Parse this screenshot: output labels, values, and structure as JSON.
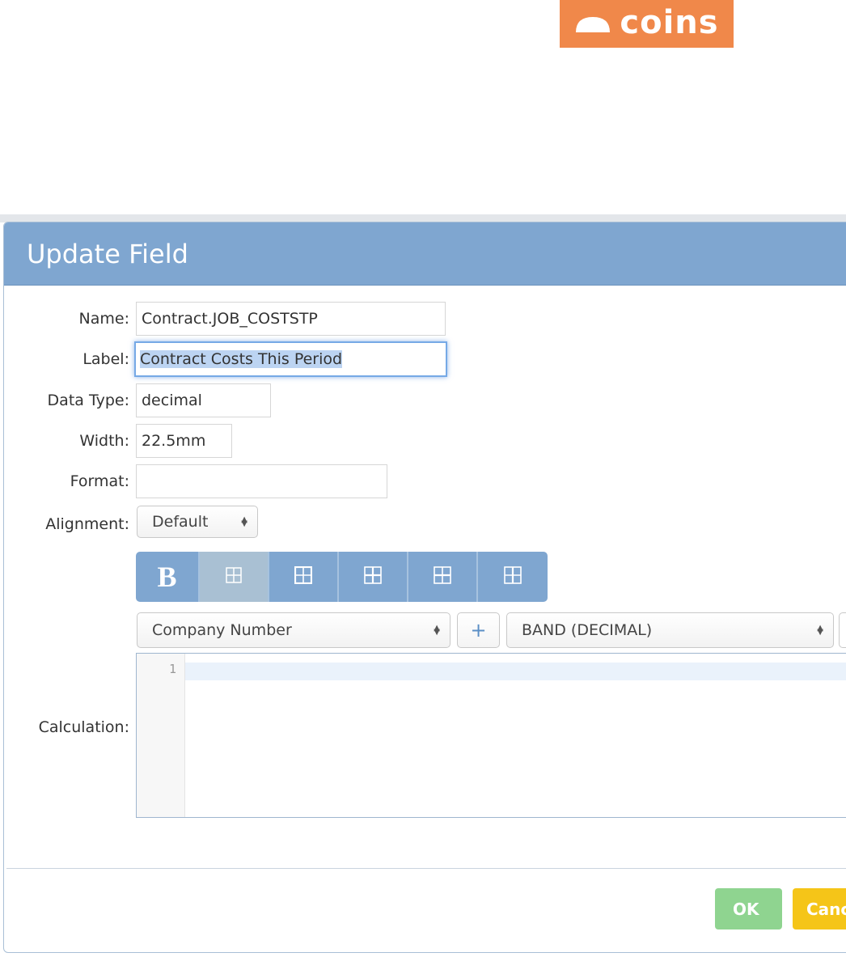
{
  "brand": {
    "logo_text": "coins",
    "color": "#f0884a",
    "icon": "hard-hat-icon"
  },
  "dialog": {
    "title": "Update Field",
    "header_color": "#7fa6d0"
  },
  "form": {
    "name": {
      "label": "Name:",
      "value": "Contract.JOB_COSTSTP"
    },
    "field_label": {
      "label": "Label:",
      "value": "Contract Costs This Period"
    },
    "data_type": {
      "label": "Data Type:",
      "value": "decimal"
    },
    "width": {
      "label": "Width:",
      "value": "22.5mm"
    },
    "format": {
      "label": "Format:",
      "value": ""
    },
    "alignment": {
      "label": "Alignment:",
      "selected": "Default"
    },
    "calculation": {
      "label": "Calculation:",
      "line_number": "1",
      "code": ""
    }
  },
  "toolbar": {
    "bold_label": "B",
    "buttons": [
      {
        "name": "bold",
        "icon": "bold-icon"
      },
      {
        "name": "border-grid",
        "icon": "grid-icon",
        "active": true
      },
      {
        "name": "border-outer",
        "icon": "grid-icon"
      },
      {
        "name": "border-inner",
        "icon": "grid-icon"
      },
      {
        "name": "border-horizontal",
        "icon": "grid-icon"
      },
      {
        "name": "border-vertical",
        "icon": "grid-icon"
      }
    ]
  },
  "calc_tools": {
    "field_select": "Company Number",
    "add_label": "+",
    "function_select": "BAND (DECIMAL)"
  },
  "footer": {
    "ok_label": "OK",
    "cancel_label": "Cancel",
    "ok_color": "#8fd490",
    "cancel_color": "#f5c518"
  }
}
